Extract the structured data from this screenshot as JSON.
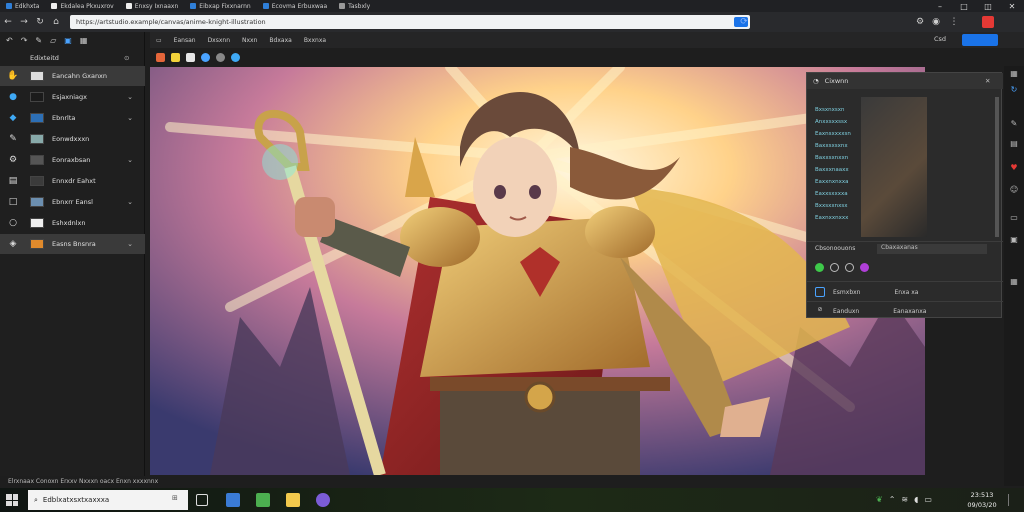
{
  "browser": {
    "tabs": [
      {
        "label": "Edkhxta",
        "icon": "app-icon"
      },
      {
        "label": "Ekdalea Pkxuxrov",
        "icon": "page-icon"
      },
      {
        "label": "Enxsy Ixnaaxn",
        "icon": "page-icon"
      },
      {
        "label": "Eibxap Fixxnarnn",
        "icon": "page-icon"
      },
      {
        "label": "Ecovma Erbuxwaa",
        "icon": "page-icon"
      },
      {
        "label": "Tasbxly",
        "icon": "page-icon"
      }
    ],
    "url": "https://artstudio.example/canvas/anime-knight-illustration"
  },
  "left_panel": {
    "title": "Edixteitd",
    "items": [
      {
        "label": "Eancahn Gxanxn",
        "icon": "layer-icon",
        "selected": true
      },
      {
        "label": "Esjaxniagx",
        "icon": "layer-icon"
      },
      {
        "label": "Ebnrlta",
        "icon": "layer-icon"
      },
      {
        "label": "Eonwdxxxn",
        "icon": "layer-icon"
      },
      {
        "label": "Eonraxbsan",
        "icon": "layer-icon"
      },
      {
        "label": "Ennxdr Eahxt",
        "icon": "layer-icon"
      },
      {
        "label": "Ebnxrr Eansl",
        "icon": "layer-icon"
      },
      {
        "label": "Eshxdnlxn",
        "icon": "layer-icon"
      },
      {
        "label": "Easns Bnsnra",
        "icon": "layer-icon",
        "selected": true
      }
    ]
  },
  "editor": {
    "tabs": [
      "Eansan",
      "Dxsxnn",
      "Nxxn",
      "Bdxaxa",
      "Bxxnxa"
    ],
    "zoom": "Csd"
  },
  "right_panel": {
    "title": "Cixwnn",
    "list": [
      "Bxsxnxsxn",
      "Anxxsxxssx",
      "Eaxnsxxxxsn",
      "Baxxsxsxnx",
      "Baxxsxnxxn",
      "Baxxxnaaxx",
      "Eaxxnxnxxa",
      "Eaxxsxxxxa",
      "Bxxsxxnxsx",
      "Eaxnxxnxxx"
    ],
    "dropdown_label": "Cbsonoouons",
    "dropdown_value": "Cbaxaxanas",
    "row1_label": "Esmxbxn",
    "row1_value": "Enxa xa",
    "row2_label": "Eanduxn",
    "row2_value": "Eanaxanxa"
  },
  "status": {
    "left": "Elrxnaax Conoxn Erxxv Nxxxn oacx Enxn xxxxnnx"
  },
  "taskbar": {
    "search_placeholder": "Edblxatxsxtxaxxxa",
    "time": "23:513",
    "date": "09/03/20"
  },
  "colors": {
    "accent": "#1a73e8",
    "panel": "#2b2b2b",
    "background": "#1e1e1e"
  }
}
